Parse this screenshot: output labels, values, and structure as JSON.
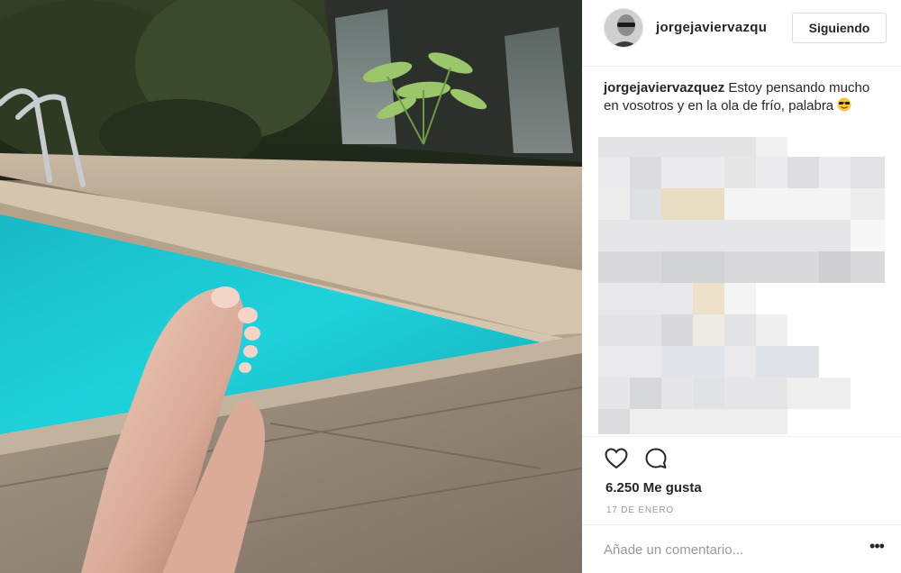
{
  "post": {
    "username": "jorgejaviervazqu",
    "follow_label": "Siguiendo",
    "caption_user": "jorgejaviervazquez",
    "caption_text": " Estoy pensando mucho en vosotros y en la ola de frío, palabra ",
    "caption_emoji": "smiling-face-with-sunglasses-icon",
    "likes": "6.250 Me gusta",
    "date": "17 DE ENERO",
    "comment_placeholder": "Añade un comentario...",
    "more_label": "•••"
  },
  "icons": {
    "like": "heart-outline-icon",
    "comment": "speech-bubble-icon"
  },
  "colors": {
    "pool_water": "#1fc8d4",
    "border": "#efefef",
    "text": "#262626",
    "muted": "#999999"
  }
}
